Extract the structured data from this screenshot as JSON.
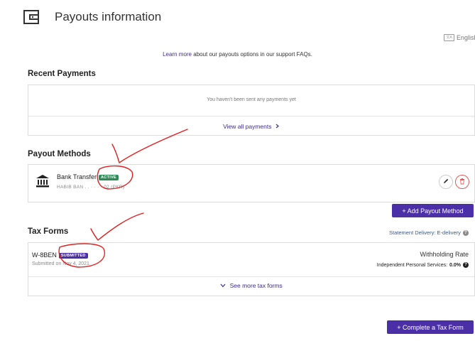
{
  "header": {
    "title": "Payouts information",
    "language": "English"
  },
  "info": {
    "learn_link": "Learn more",
    "learn_rest": " about our payouts options in our support FAQs."
  },
  "recent_payments": {
    "title": "Recent Payments",
    "empty_text": "You haven't been sent any payments yet",
    "view_all": "View all payments"
  },
  "payout_methods": {
    "title": "Payout Methods",
    "method_name": "Bank Transfer",
    "status": "ACTIVE",
    "account_masked": "HABIB BAN . . · · · · 02 (PKR)",
    "add_button": "+ Add Payout Method"
  },
  "tax_forms": {
    "title": "Tax Forms",
    "statement_delivery": "Statement Delivery: E-delivery",
    "form_name": "W-8BEN",
    "form_status": "SUBMITTED",
    "submitted_on": "Submitted on Nov 4, 2021",
    "withholding_label": "Withholding Rate",
    "withholding_detail_label": "Independent Personal Services:",
    "withholding_detail_value": "0.0%",
    "see_more": "See more tax forms",
    "complete_button": "+ Complete a Tax Form"
  },
  "colors": {
    "accent": "#4b2fa6",
    "active_badge": "#2e8b57",
    "delete_icon": "#e05a5a",
    "annotation_ink": "#e02020"
  },
  "icons": [
    "wallet-icon",
    "language-icon",
    "chevron-right-icon",
    "bank-icon",
    "pencil-icon",
    "trash-icon",
    "help-icon",
    "chevron-down-icon"
  ]
}
